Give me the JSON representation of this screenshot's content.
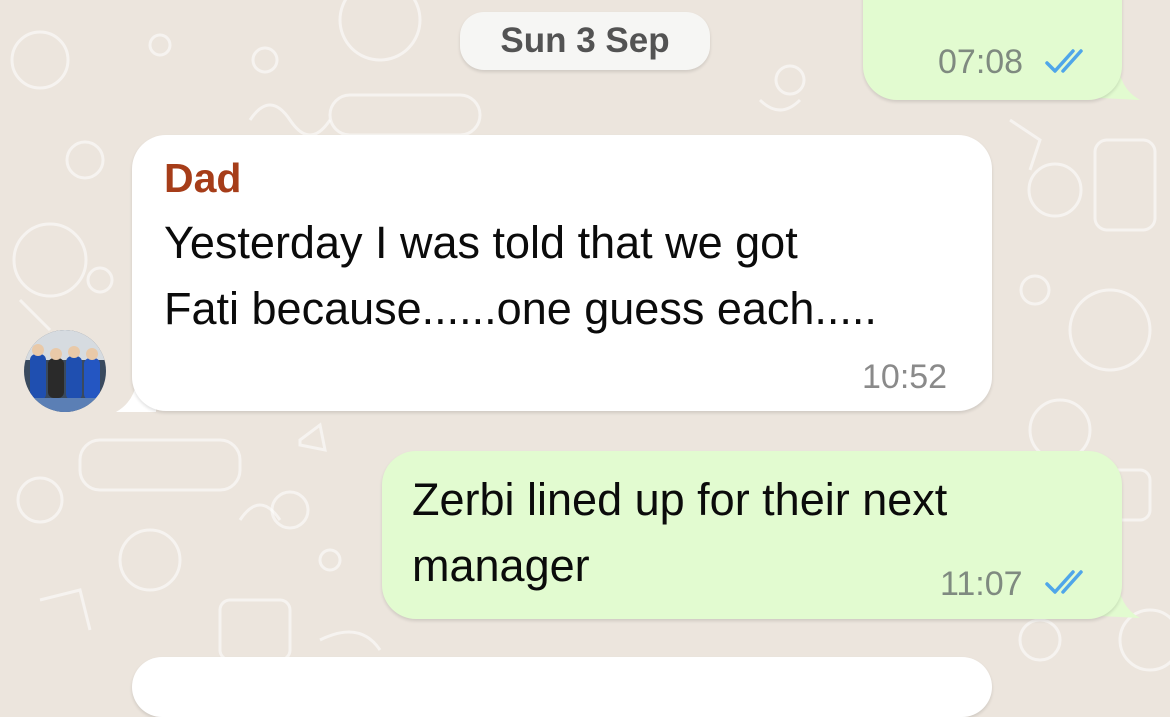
{
  "chat": {
    "date_separator": "Sun 3 Sep",
    "messages": [
      {
        "direction": "outgoing",
        "time": "07:08",
        "status": "read",
        "status_icon": "double-check-icon"
      },
      {
        "direction": "incoming",
        "sender": "Dad",
        "text_lines": [
          "Yesterday I was told that we got",
          "Fati because......one guess each....."
        ],
        "time": "10:52"
      },
      {
        "direction": "outgoing",
        "text_lines": [
          "Zerbi lined up for their next",
          "manager"
        ],
        "time": "11:07",
        "status": "read",
        "status_icon": "double-check-icon"
      },
      {
        "direction": "incoming"
      }
    ]
  },
  "colors": {
    "wallpaper": "#ece5dd",
    "outgoing_bubble": "#e2fbd0",
    "incoming_bubble": "#ffffff",
    "sender_name": "#a63d19",
    "read_ticks": "#4fa6e9"
  }
}
